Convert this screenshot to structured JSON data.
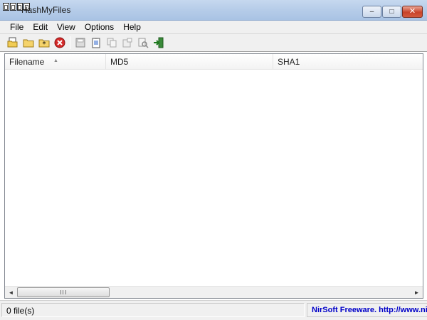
{
  "window": {
    "title": "HashMyFiles",
    "buttons": {
      "minimize": "–",
      "maximize": "□",
      "close": "✕"
    }
  },
  "menu": {
    "items": [
      "File",
      "Edit",
      "View",
      "Options",
      "Help"
    ]
  },
  "toolbar": {
    "buttons": [
      {
        "icon": "open-file-icon"
      },
      {
        "icon": "open-folder-icon"
      },
      {
        "icon": "add-by-wildcard-icon"
      },
      {
        "icon": "delete-icon"
      },
      {
        "icon": "save-icon"
      },
      {
        "icon": "copy-to-clipboard-icon"
      },
      {
        "icon": "copy-hash-icon"
      },
      {
        "icon": "properties-icon"
      },
      {
        "icon": "find-icon"
      },
      {
        "icon": "exit-icon"
      }
    ]
  },
  "list": {
    "columns": [
      "Filename",
      "MD5",
      "SHA1"
    ],
    "sort_indicator": "▲",
    "sorted_column": "Filename",
    "rows": []
  },
  "scrollbar": {
    "left_arrow": "◄",
    "right_arrow": "►"
  },
  "status": {
    "file_count": "0 file(s)",
    "credit": "NirSoft Freeware.  http://www.nirsoft.net"
  },
  "colors": {
    "credit_text": "#0000c8",
    "titlebar": "#b7cde9",
    "close_button": "#c8432a"
  }
}
